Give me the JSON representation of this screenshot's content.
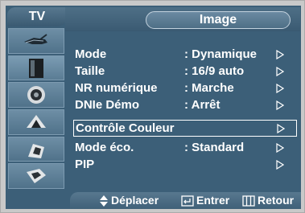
{
  "header": {
    "tv_label": "TV",
    "title": "Image"
  },
  "sidebar": {
    "items": [
      {
        "icon": "antenna-icon"
      },
      {
        "icon": "picture-icon"
      },
      {
        "icon": "sound-icon"
      },
      {
        "icon": "setup-icon"
      },
      {
        "icon": "input-icon"
      },
      {
        "icon": "extras-icon"
      }
    ]
  },
  "menu": {
    "items": [
      {
        "label": "Mode",
        "value": ": Dynamique"
      },
      {
        "label": "Taille",
        "value": ": 16/9 auto"
      },
      {
        "label": "NR numérique",
        "value": ": Marche"
      },
      {
        "label": "DNIe Démo",
        "value": ": Arrêt"
      },
      {
        "label": "Contrôle Couleur",
        "value": ""
      },
      {
        "label": "Mode éco.",
        "value": ": Standard"
      },
      {
        "label": "PIP",
        "value": ""
      }
    ]
  },
  "footer": {
    "move_label": "Déplacer",
    "enter_label": "Entrer",
    "return_label": "Retour"
  },
  "colors": {
    "background": "#3c5f78",
    "frame": "#c9c9c9",
    "text": "#ffffff"
  }
}
